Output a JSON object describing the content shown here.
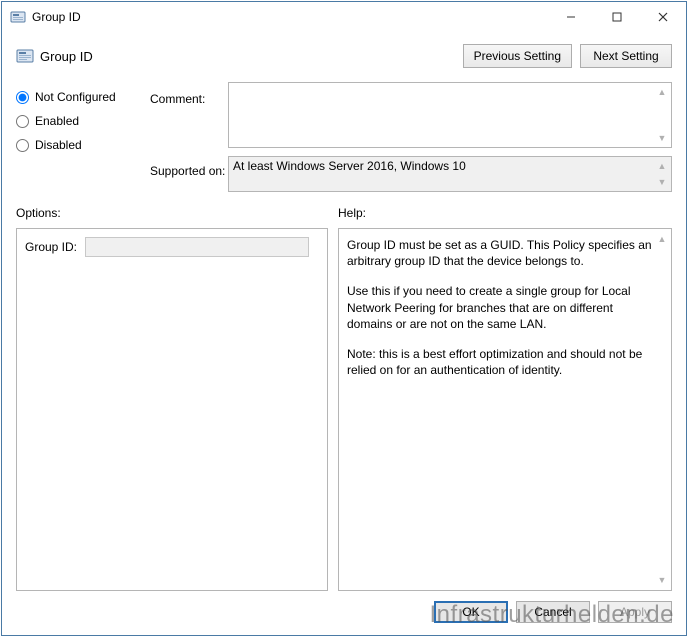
{
  "window": {
    "title": "Group ID"
  },
  "header": {
    "title": "Group ID"
  },
  "nav": {
    "previous": "Previous Setting",
    "next": "Next Setting"
  },
  "state": {
    "radios": [
      {
        "label": "Not Configured",
        "checked": true
      },
      {
        "label": "Enabled",
        "checked": false
      },
      {
        "label": "Disabled",
        "checked": false
      }
    ],
    "comment_label": "Comment:",
    "comment_value": "",
    "supported_label": "Supported on:",
    "supported_value": "At least Windows Server 2016, Windows 10"
  },
  "labels": {
    "options": "Options:",
    "help": "Help:"
  },
  "options": {
    "groupid_label": "Group ID:",
    "groupid_value": ""
  },
  "help": {
    "p1": "Group ID must be set as a GUID. This Policy specifies an arbitrary group ID that the device belongs to.",
    "p2": "Use this if you need to create a single group for Local Network Peering for branches that are on different domains or are not on the same LAN.",
    "p3": "Note: this is a best effort optimization and should not be relied on for an authentication of identity."
  },
  "footer": {
    "ok": "OK",
    "cancel": "Cancel",
    "apply": "Apply"
  },
  "watermark": "Infrastrukturhelden.de"
}
